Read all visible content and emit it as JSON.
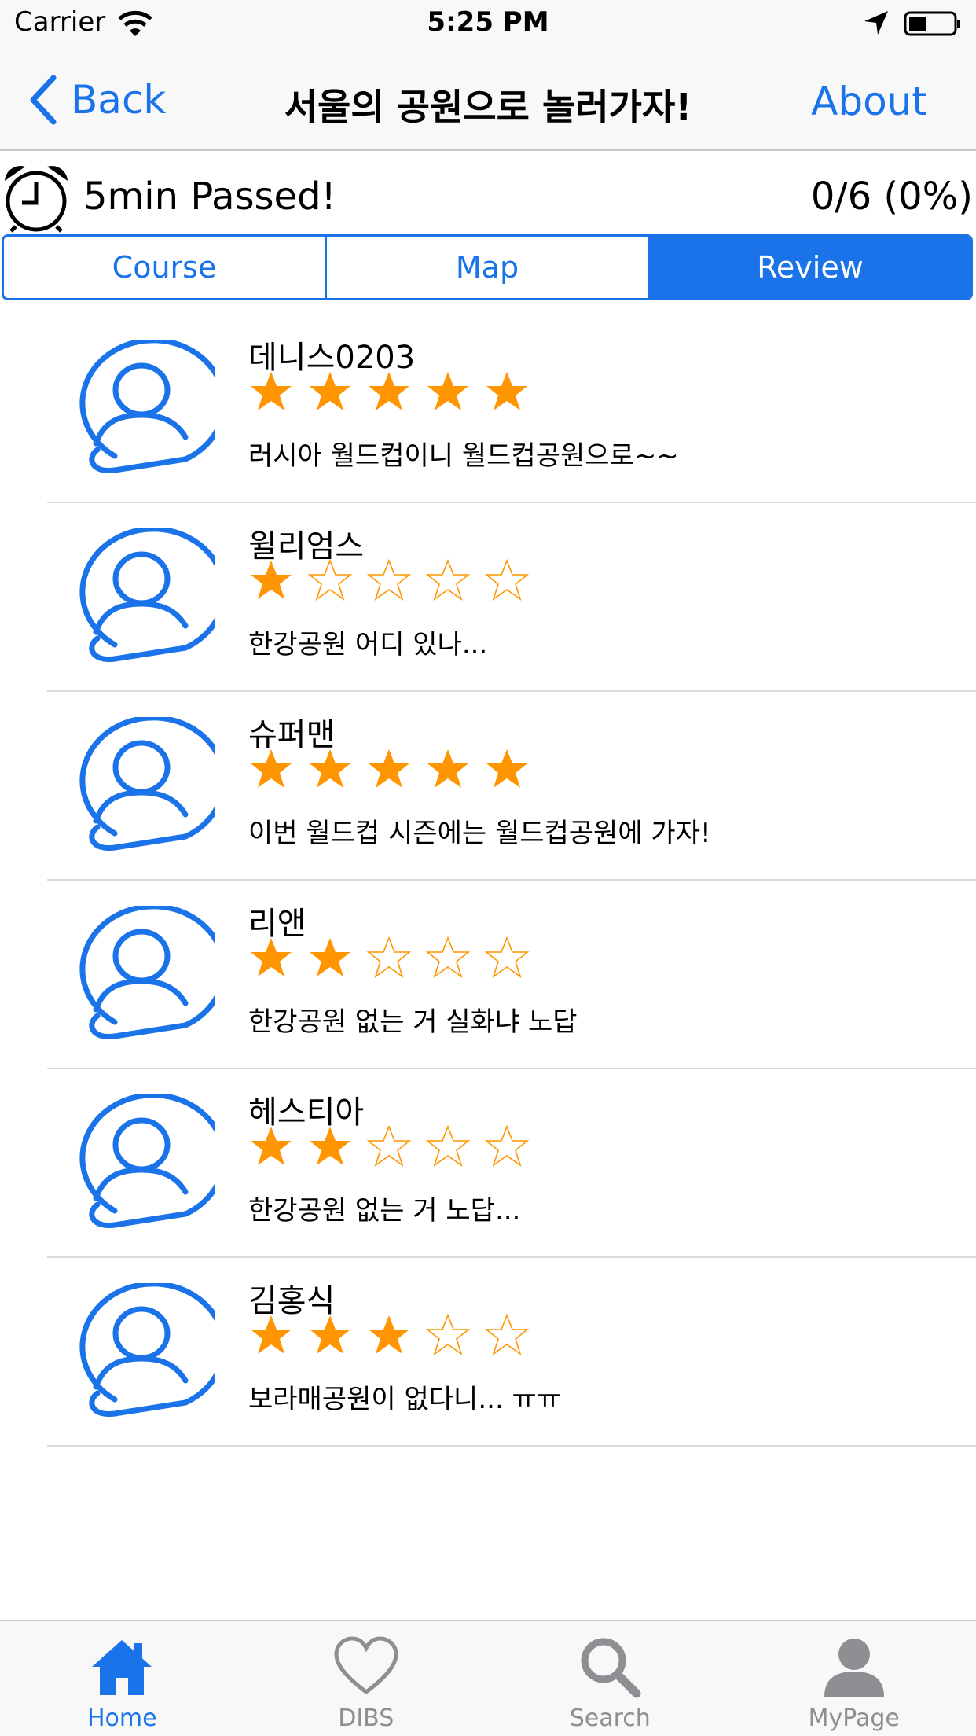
{
  "status_bar": {
    "carrier": "Carrier",
    "time": "5:25 PM"
  },
  "nav": {
    "back_label": "Back",
    "title": "서울의 공원으로 놀러가자!",
    "about_label": "About"
  },
  "timer": {
    "text": "5min Passed!",
    "progress": "0/6 (0%)"
  },
  "segments": [
    {
      "label": "Course",
      "active": false
    },
    {
      "label": "Map",
      "active": false
    },
    {
      "label": "Review",
      "active": true
    }
  ],
  "reviews": [
    {
      "name": "데니스0203",
      "rating": 5,
      "comment": "러시아 월드컵이니 월드컵공원으로~~"
    },
    {
      "name": "윌리엄스",
      "rating": 1,
      "comment": "한강공원 어디 있나..."
    },
    {
      "name": "슈퍼맨",
      "rating": 5,
      "comment": "이번 월드컵 시즌에는 월드컵공원에 가자!"
    },
    {
      "name": "리앤",
      "rating": 2,
      "comment": "한강공원 없는 거 실화냐 노답"
    },
    {
      "name": "헤스티아",
      "rating": 2,
      "comment": "한강공원 없는 거 노답..."
    },
    {
      "name": "김홍식",
      "rating": 3,
      "comment": "보라매공원이 없다니... ㅠㅠ"
    }
  ],
  "tabbar": [
    {
      "label": "Home",
      "icon": "home-icon",
      "active": true
    },
    {
      "label": "DIBS",
      "icon": "heart-icon",
      "active": false
    },
    {
      "label": "Search",
      "icon": "search-icon",
      "active": false
    },
    {
      "label": "MyPage",
      "icon": "person-icon",
      "active": false
    }
  ],
  "colors": {
    "accent": "#1a73e8",
    "star": "#ff9500",
    "inactive": "#8e8e93"
  }
}
